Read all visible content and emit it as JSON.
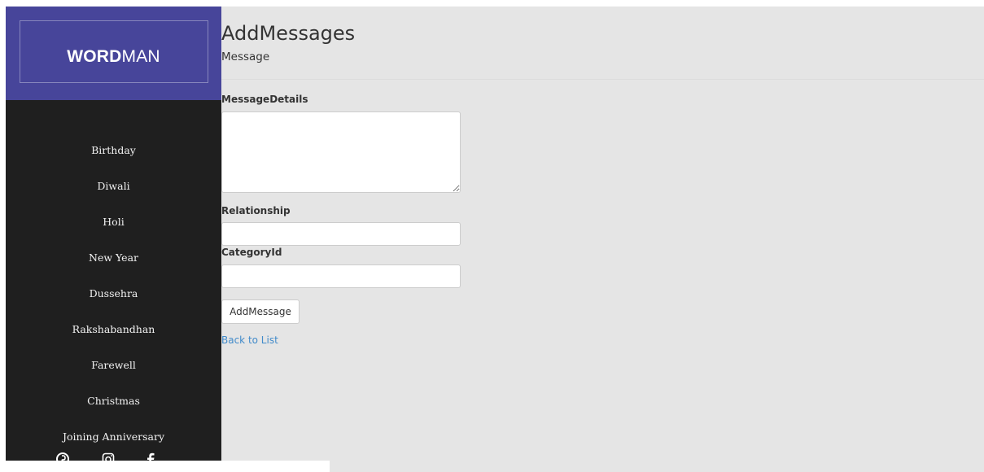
{
  "brand": {
    "bold": "WORD",
    "light": "MAN",
    "color": "#47459a"
  },
  "sidebar": {
    "background": "#1f1f1f",
    "items": [
      {
        "label": "Birthday"
      },
      {
        "label": "Diwali"
      },
      {
        "label": "Holi"
      },
      {
        "label": "New Year"
      },
      {
        "label": "Dussehra"
      },
      {
        "label": "Rakshabandhan"
      },
      {
        "label": "Farewell"
      },
      {
        "label": "Christmas"
      },
      {
        "label": "Joining Anniversary"
      }
    ],
    "social_icons": [
      "pinterest-icon",
      "instagram-icon",
      "facebook-icon"
    ]
  },
  "main": {
    "title": "AddMessages",
    "subtitle": "Message",
    "form": {
      "message_details_label": "MessageDetails",
      "message_details_value": "",
      "relationship_label": "Relationship",
      "relationship_value": "",
      "category_id_label": "CategoryId",
      "category_id_value": "",
      "submit_label": "AddMessage"
    },
    "back_link": "Back to List",
    "link_color": "#428bca"
  }
}
